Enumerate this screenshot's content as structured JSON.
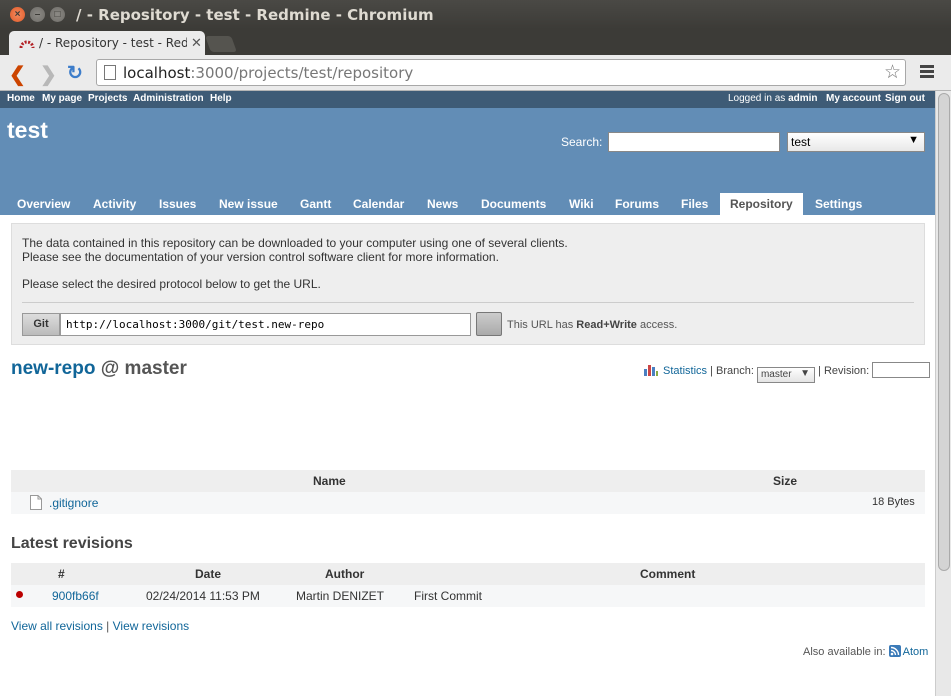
{
  "browser": {
    "window_title": "/ - Repository - test - Redmine - Chromium",
    "tab_title": "/ - Repository - test - Red",
    "url_host": "localhost",
    "url_rest": ":3000/projects/test/repository"
  },
  "topmenu": {
    "home": "Home",
    "my_page": "My page",
    "projects": "Projects",
    "administration": "Administration",
    "help": "Help",
    "logged_in_prefix": "Logged in as",
    "user": "admin",
    "my_account": "My account",
    "sign_out": "Sign out"
  },
  "header": {
    "project_title": "test",
    "search_label": "Search:",
    "project_select": "test"
  },
  "main_menu": [
    "Overview",
    "Activity",
    "Issues",
    "New issue",
    "Gantt",
    "Calendar",
    "News",
    "Documents",
    "Wiki",
    "Forums",
    "Files",
    "Repository",
    "Settings"
  ],
  "download": {
    "line1": "The data contained in this repository can be downloaded to your computer using one of several clients.",
    "line2": "Please see the documentation of your version control software client for more information.",
    "line3": "Please select the desired protocol below to get the URL.",
    "protocol": "Git",
    "git_url": "http://localhost:3000/git/test.new-repo",
    "access_prefix": "This URL has",
    "access_level": "Read+Write",
    "access_suffix": "access."
  },
  "repo": {
    "name": "new-repo",
    "at": "@",
    "branch": "master",
    "statistics": "Statistics",
    "branch_label": "| Branch:",
    "branch_value": "master",
    "revision_label": "| Revision:"
  },
  "files_table": {
    "headers": {
      "name": "Name",
      "size": "Size"
    },
    "rows": [
      {
        "name": ".gitignore",
        "size": "18 Bytes"
      }
    ]
  },
  "revisions": {
    "heading": "Latest revisions",
    "headers": {
      "num": "#",
      "date": "Date",
      "author": "Author",
      "comment": "Comment"
    },
    "rows": [
      {
        "rev": "900fb66f",
        "date": "02/24/2014 11:53 PM",
        "author": "Martin DENIZET",
        "comment": "First Commit"
      }
    ]
  },
  "footer": {
    "view_all": "View all revisions",
    "sep": "|",
    "view": "View revisions",
    "also_available": "Also available in:",
    "atom": "Atom"
  },
  "colors": {
    "header_bg": "#628db6",
    "topmenu_bg": "#3e5b76",
    "link": "#116699"
  }
}
